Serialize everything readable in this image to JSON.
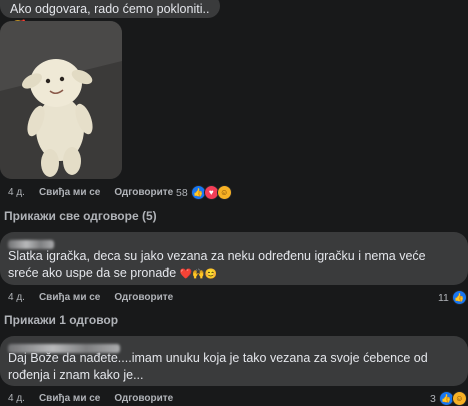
{
  "comment1": {
    "text": "Ako odgovara, rado ćemo pokloniti..🥰",
    "time": "4 д.",
    "like": "Свиђа ми се",
    "reply": "Одговорите",
    "reactions_count": "58"
  },
  "view_all_replies": "Прикажи све одговоре (5)",
  "comment2": {
    "text": "Slatka igračka, deca su jako vezana za neku određenu igračku i nema veće sreće ako uspe da se pronađe",
    "emojis": "❤️🙌😊",
    "time": "4 д.",
    "like": "Свиђа ми се",
    "reply": "Одговорите",
    "reactions_count": "11"
  },
  "view_one_reply": "Прикажи 1 одговор",
  "comment3": {
    "text": "Daj Bože da nađete....imam unuku koja je tako vezana za svoje ćebence od rođenja i znam kako je...",
    "time": "4 д.",
    "like": "Свиђа ми се",
    "reply": "Одговорите",
    "reactions_count": "3"
  },
  "icons": [
    "like-reaction-icon",
    "love-reaction-icon",
    "care-reaction-icon"
  ],
  "colors": {
    "background": "#18191a",
    "bubble": "#3a3b3c",
    "secondary_text": "#b0b3b8",
    "like_blue": "#1877f2"
  }
}
